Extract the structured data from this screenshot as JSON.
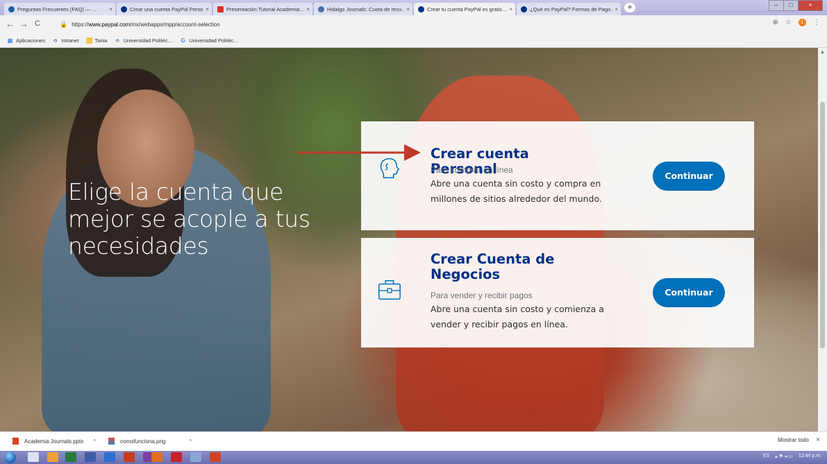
{
  "browser": {
    "tabs": [
      {
        "title": "Preguntas Frecuentes (FAQ) — …",
        "color": "#1f5fa8"
      },
      {
        "title": "Crear una cuenta PayPal Person…",
        "color": "#003087"
      },
      {
        "title": "Presentación Tutorial Academia…",
        "color": "#d93025"
      },
      {
        "title": "Hidalgo Journals: Cuota de recu…",
        "color": "#4a6fa8"
      },
      {
        "title": "Crear tu cuenta PayPal es gratis…",
        "color": "#003087"
      },
      {
        "title": "¿Qué es PayPal? Formas de Pago…",
        "color": "#003087"
      }
    ],
    "close_glyph": "×",
    "new_tab_glyph": "+",
    "nav": {
      "back": "←",
      "forward": "→",
      "reload": "C"
    },
    "url_prefix": "https://",
    "url_host": "www.paypal.com",
    "url_path": "/mx/webapps/mpp/account-selection",
    "lock_glyph": "🔒",
    "zoom_glyph": "⊕",
    "star_glyph": "☆",
    "menu_glyph": "⋮",
    "extension_badge": "1",
    "bookmarks": [
      {
        "label": "Aplicaciones",
        "icon": "apps-icon"
      },
      {
        "label": "Intranet",
        "icon": "bookmark-logo-icon"
      },
      {
        "label": "Tania",
        "icon": "folder-icon"
      },
      {
        "label": "Universidad Politéc…",
        "icon": "bookmark-logo-icon"
      },
      {
        "label": "Universidad Politéc…",
        "icon": "bookmark-google-icon"
      }
    ]
  },
  "page": {
    "hero": "Elige la cuenta que mejor se acople a tus necesidades",
    "cards": [
      {
        "title": "Crear cuenta Personal",
        "subtitle": "Para comprar en línea",
        "description": "Abre una cuenta sin costo y compra en millones de sitios alrededor del mundo.",
        "button": "Continuar",
        "icon": "person-head-icon"
      },
      {
        "title": "Crear Cuenta de Negocios",
        "subtitle": "Para vender y recibir pagos",
        "description": "Abre una cuenta sin costo y comienza a vender y recibir pagos en línea.",
        "button": "Continuar",
        "icon": "briefcase-icon"
      }
    ],
    "colors": {
      "brand_dark": "#003087",
      "button": "#0070ba",
      "arrow": "#c0392b"
    }
  },
  "downloads": {
    "items": [
      {
        "name": "Academia Journals.pptx",
        "icon": "powerpoint-file-icon"
      },
      {
        "name": "comofunciona.png",
        "icon": "image-file-icon"
      }
    ],
    "show_all": "Mostrar todo",
    "close_glyph": "×",
    "chevron_glyph": "^"
  },
  "taskbar": {
    "language": "ES",
    "time": "12:44 p.m."
  }
}
